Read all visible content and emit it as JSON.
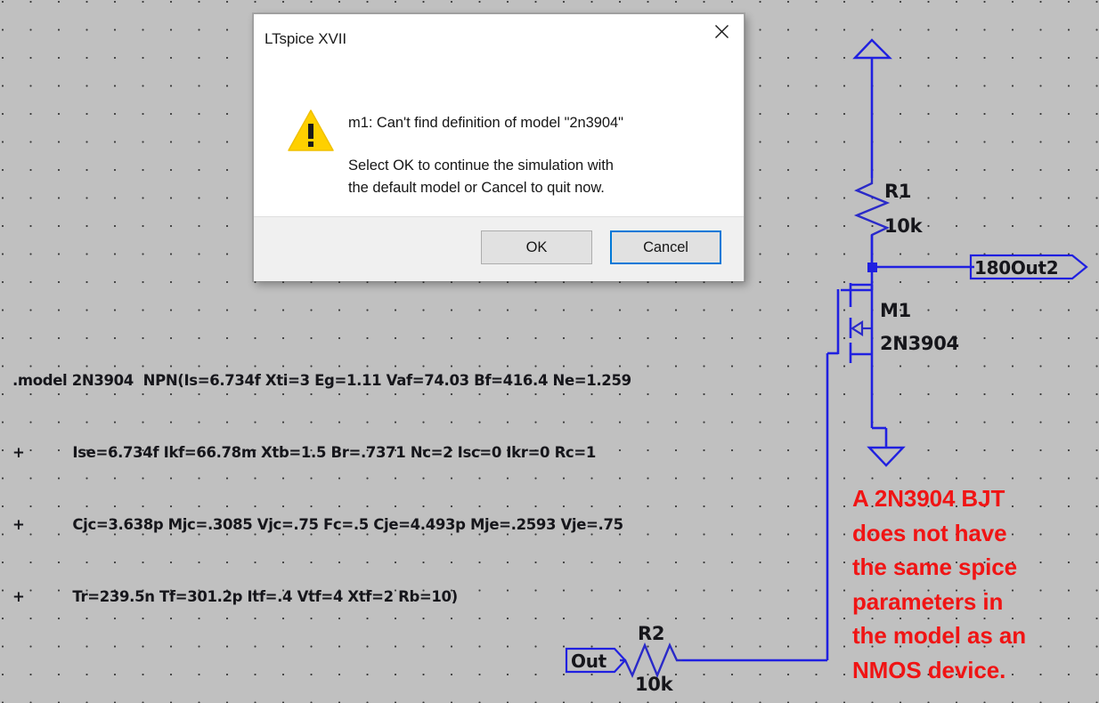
{
  "app": {
    "canvas_bg": "#c0c0c0",
    "wire_color": "#2020e0",
    "note_color": "#f01414"
  },
  "dialog": {
    "title": "LTspice XVII",
    "close_icon": "close-icon",
    "warning_icon": "warning-triangle-icon",
    "message_main": "m1: Can't find definition of model \"2n3904\"",
    "message_sub": "Select OK to continue the simulation with\nthe default model or Cancel to quit now.",
    "buttons": {
      "ok": "OK",
      "cancel": "Cancel"
    }
  },
  "spice_directive": {
    "lines": [
      ".model 2N3904  NPN(Is=6.734f Xti=3 Eg=1.11 Vaf=74.03 Bf=416.4 Ne=1.259",
      "+          Ise=6.734f Ikf=66.78m Xtb=1.5 Br=.7371 Nc=2 Isc=0 Ikr=0 Rc=1",
      "+          Cjc=3.638p Mjc=.3085 Vjc=.75 Fc=.5 Cje=4.493p Mje=.2593 Vje=.75",
      "+          Tr=239.5n Tf=301.2p Itf=.4 Vtf=4 Xtf=2 Rb=10)"
    ]
  },
  "schematic": {
    "components": [
      {
        "designator": "R1",
        "value": "10k",
        "type": "resistor"
      },
      {
        "designator": "M1",
        "value": "2N3904",
        "type": "nmos"
      },
      {
        "designator": "R2",
        "value": "10k",
        "type": "resistor"
      }
    ],
    "net_labels": [
      {
        "name": "180Out2"
      },
      {
        "name": "Out"
      }
    ],
    "symbols": [
      {
        "name": "vdd-arrow"
      },
      {
        "name": "ground-symbol"
      },
      {
        "name": "junction-dot"
      }
    ]
  },
  "annotation": {
    "text": "A 2N3904 BJT\ndoes not have\nthe same spice\nparameters in\nthe model as an\nNMOS device."
  }
}
